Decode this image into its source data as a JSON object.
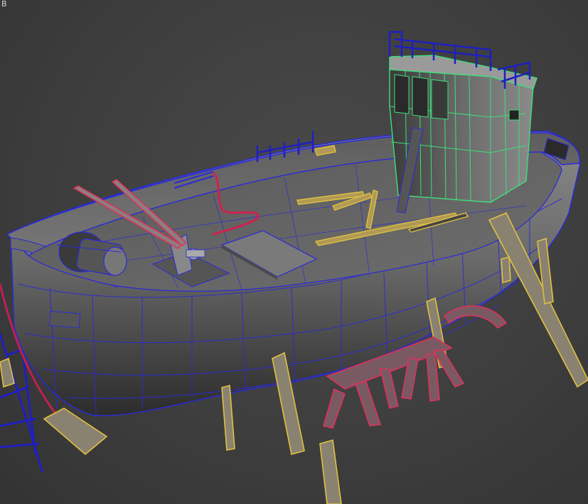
{
  "viewport": {
    "corner_label": "B",
    "view": "perspective",
    "shading": "shaded-with-wireframe-edges"
  },
  "colors": {
    "background": "#3d3d3d",
    "hull_wire": "#2a2ad8",
    "cabin_wire": "#3ee07a",
    "railing_wire": "#1f1fc0",
    "support_wire": "#e0c040",
    "stand_wire": "#e0305a",
    "pipe_wire": "#d02050"
  },
  "objects": [
    {
      "name": "hull",
      "wire_color": "hull_wire"
    },
    {
      "name": "wheelhouse",
      "wire_color": "cabin_wire"
    },
    {
      "name": "wheelhouse-railing",
      "wire_color": "railing_wire"
    },
    {
      "name": "winch-drum",
      "wire_color": "hull_wire"
    },
    {
      "name": "deck-hatch",
      "wire_color": "hull_wire"
    },
    {
      "name": "timber-props",
      "wire_color": "support_wire"
    },
    {
      "name": "sawhorse-stands",
      "wire_color": "stand_wire"
    },
    {
      "name": "bow-rail",
      "wire_color": "railing_wire"
    },
    {
      "name": "scaffold-ladder",
      "wire_color": "railing_wire"
    }
  ]
}
